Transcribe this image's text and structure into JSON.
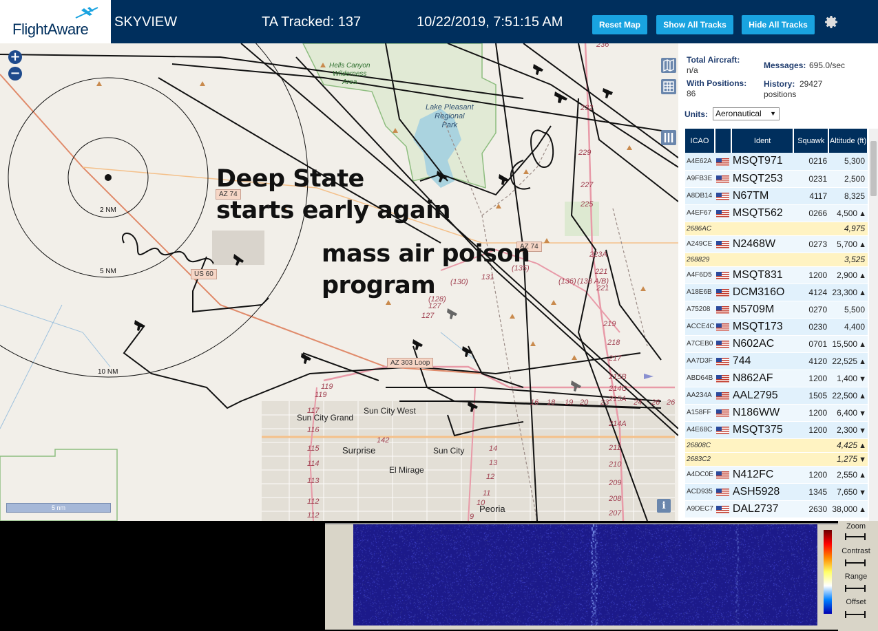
{
  "header": {
    "logo_text": "FlightAware",
    "app_name": "SKYVIEW",
    "ta_tracked": "TA Tracked: 137",
    "datetime": "10/22/2019, 7:51:15 AM",
    "buttons": {
      "reset": "Reset Map",
      "show_all": "Show All Tracks",
      "hide_all": "Hide All Tracks"
    },
    "settings_icon": "gear-icon"
  },
  "map": {
    "annotation_1": [
      "Deep State",
      "starts early again"
    ],
    "annotation_2": [
      "mass air poison",
      "program"
    ],
    "ring_labels": [
      "2 NM",
      "5 NM",
      "10 NM"
    ],
    "scale_label": "5 nm",
    "zoom": {
      "in": "+",
      "out": "−"
    },
    "info": "i",
    "places": {
      "hells_canyon": [
        "Hells Canyon",
        "Wilderness",
        "Area"
      ],
      "lake_pleasant": [
        "Lake Pleasant",
        "Regional",
        "Park"
      ],
      "sun_city_grand": "Sun City Grand",
      "sun_city_west": "Sun City West",
      "surprise": "Surprise",
      "sun_city": "Sun City",
      "el_mirage": "El Mirage",
      "peoria": "Peoria"
    },
    "road_shields": [
      "AZ 74",
      "AZ 74",
      "US 60",
      "AZ 303 Loop"
    ],
    "route_numbers": [
      "(135)",
      "(130)",
      "131",
      "(128)",
      "127",
      "127",
      "(136)",
      "(138 A/B)",
      "221",
      "221",
      "223A",
      "219",
      "218",
      "217",
      "215B",
      "214C",
      "215A",
      "214A",
      "211",
      "210",
      "209",
      "208",
      "207",
      "229",
      "227",
      "225",
      "232",
      "236",
      "119",
      "119",
      "117",
      "116",
      "115",
      "114",
      "113",
      "112",
      "112",
      "142",
      "14",
      "13",
      "12",
      "11",
      "10",
      "9",
      "16",
      "18",
      "19",
      "20",
      "23",
      "24",
      "26",
      "26"
    ]
  },
  "panel": {
    "total_aircraft_label": "Total Aircraft:",
    "total_aircraft_value": "n/a",
    "with_positions_label": "With Positions:",
    "with_positions_value": "86",
    "messages_label": "Messages:",
    "messages_value": "695.0/sec",
    "history_label": "History:",
    "history_value": "29427",
    "history_unit": "positions",
    "units_label": "Units:",
    "units_value": "Aeronautical",
    "columns": [
      "ICAO",
      "",
      "Ident",
      "Squawk",
      "Altitude (ft)"
    ],
    "rows": [
      {
        "icao": "A4E62A",
        "flag": "us-flag-icon",
        "ident": "MSQT971",
        "squawk": "0216",
        "alt": "5,300",
        "trend": ""
      },
      {
        "icao": "A9FB3E",
        "flag": "us-flag-icon",
        "ident": "MSQT253",
        "squawk": "0231",
        "alt": "2,500",
        "trend": ""
      },
      {
        "icao": "A8DB14",
        "flag": "us-flag-icon",
        "ident": "N67TM",
        "squawk": "4117",
        "alt": "8,325",
        "trend": ""
      },
      {
        "icao": "A4EF67",
        "flag": "us-flag-icon",
        "ident": "MSQT562",
        "squawk": "0266",
        "alt": "4,500",
        "trend": "▲"
      },
      {
        "icao": "2686AC",
        "flag": "",
        "ident": "",
        "squawk": "",
        "alt": "4,975",
        "trend": ""
      },
      {
        "icao": "A249CE",
        "flag": "us-flag-icon",
        "ident": "N2468W",
        "squawk": "0273",
        "alt": "5,700",
        "trend": "▲"
      },
      {
        "icao": "268829",
        "flag": "",
        "ident": "",
        "squawk": "",
        "alt": "3,525",
        "trend": ""
      },
      {
        "icao": "A4F6D5",
        "flag": "us-flag-icon",
        "ident": "MSQT831",
        "squawk": "1200",
        "alt": "2,900",
        "trend": "▲"
      },
      {
        "icao": "A18E6B",
        "flag": "us-flag-icon",
        "ident": "DCM316O",
        "squawk": "4124",
        "alt": "23,300",
        "trend": "▲"
      },
      {
        "icao": "A75208",
        "flag": "us-flag-icon",
        "ident": "N5709M",
        "squawk": "0270",
        "alt": "5,500",
        "trend": ""
      },
      {
        "icao": "ACCE4C",
        "flag": "us-flag-icon",
        "ident": "MSQT173",
        "squawk": "0230",
        "alt": "4,400",
        "trend": ""
      },
      {
        "icao": "A7CEB0",
        "flag": "us-flag-icon",
        "ident": "N602AC",
        "squawk": "0701",
        "alt": "15,500",
        "trend": "▲"
      },
      {
        "icao": "AA7D3F",
        "flag": "us-flag-icon",
        "ident": "744",
        "squawk": "4120",
        "alt": "22,525",
        "trend": "▲"
      },
      {
        "icao": "ABD64B",
        "flag": "us-flag-icon",
        "ident": "N862AF",
        "squawk": "1200",
        "alt": "1,400",
        "trend": "▼"
      },
      {
        "icao": "AA234A",
        "flag": "us-flag-icon",
        "ident": "AAL2795",
        "squawk": "1505",
        "alt": "22,500",
        "trend": "▲"
      },
      {
        "icao": "A158FF",
        "flag": "us-flag-icon",
        "ident": "N186WW",
        "squawk": "1200",
        "alt": "6,400",
        "trend": "▼"
      },
      {
        "icao": "A4E68C",
        "flag": "us-flag-icon",
        "ident": "MSQT375",
        "squawk": "1200",
        "alt": "2,300",
        "trend": "▼"
      },
      {
        "icao": "26808C",
        "flag": "",
        "ident": "",
        "squawk": "",
        "alt": "4,425",
        "trend": "▲"
      },
      {
        "icao": "2683C2",
        "flag": "",
        "ident": "",
        "squawk": "",
        "alt": "1,275",
        "trend": "▼"
      },
      {
        "icao": "A4DC0E",
        "flag": "us-flag-icon",
        "ident": "N412FC",
        "squawk": "1200",
        "alt": "2,550",
        "trend": "▲"
      },
      {
        "icao": "ACD935",
        "flag": "us-flag-icon",
        "ident": "ASH5928",
        "squawk": "1345",
        "alt": "7,650",
        "trend": "▼"
      },
      {
        "icao": "A9DEC7",
        "flag": "us-flag-icon",
        "ident": "DAL2737",
        "squawk": "2630",
        "alt": "38,000",
        "trend": "▲"
      }
    ]
  },
  "spectrum": {
    "controls": [
      "Zoom",
      "Contrast",
      "Range",
      "Offset"
    ],
    "colors": {
      "bg": "#1c1a8a",
      "accent": "#19a3e0",
      "header": "#002f5d"
    }
  }
}
